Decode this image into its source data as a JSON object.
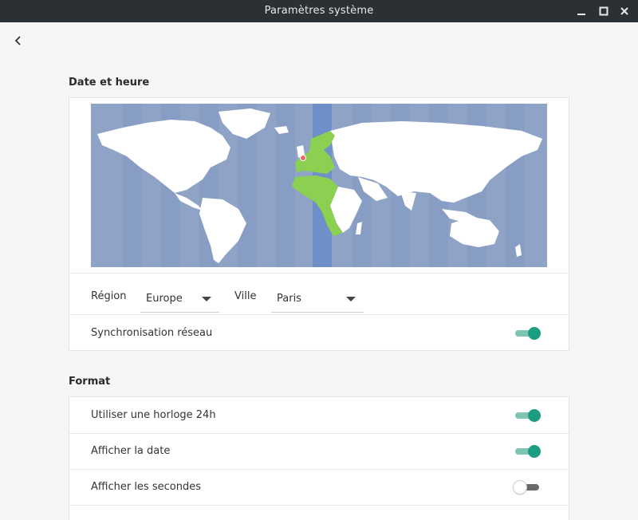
{
  "window": {
    "title": "Paramètres système"
  },
  "date_time": {
    "section_title": "Date et heure",
    "region_label": "Région",
    "region_value": "Europe",
    "city_label": "Ville",
    "city_value": "Paris",
    "network_sync_label": "Synchronisation réseau",
    "network_sync_on": true
  },
  "format": {
    "section_title": "Format",
    "items": [
      {
        "label": "Utiliser une horloge 24h",
        "on": true
      },
      {
        "label": "Afficher la date",
        "on": true
      },
      {
        "label": "Afficher les secondes",
        "on": false
      }
    ]
  },
  "colors": {
    "accent": "#1c9c80",
    "map_ocean": "#8ea3c6",
    "timezone_highlight": "#6f8fc9",
    "timezone_land": "#8cd052",
    "titlebar": "#2b3035"
  }
}
